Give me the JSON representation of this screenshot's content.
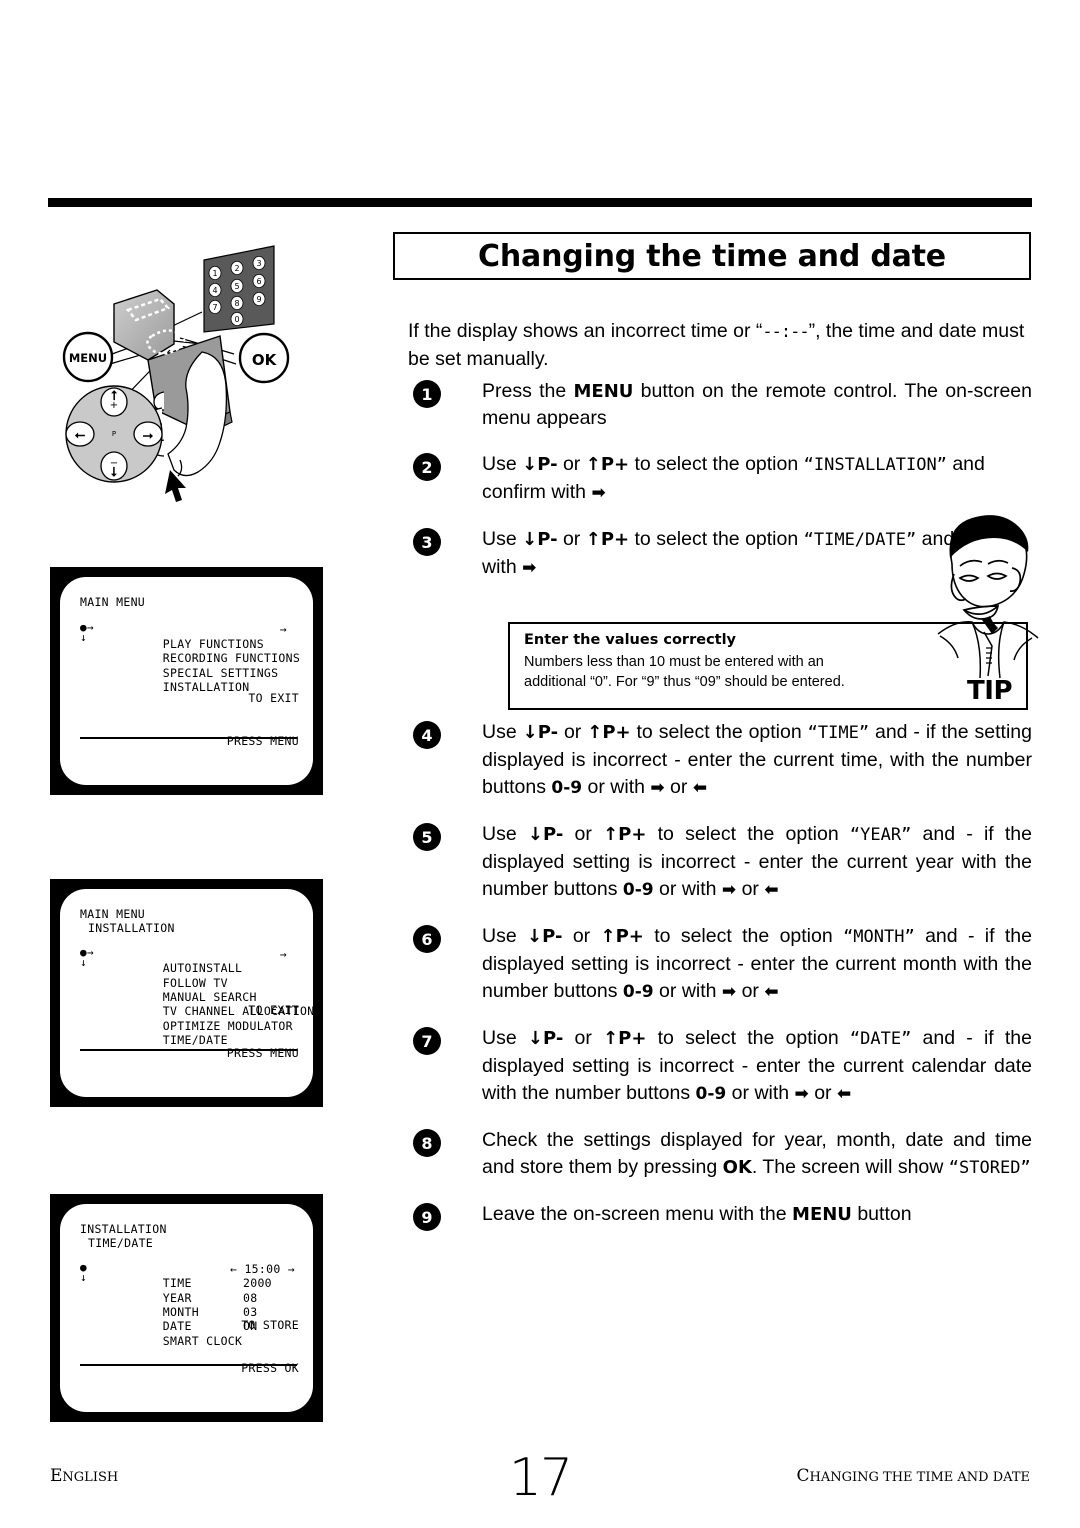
{
  "page": {
    "title": "Changing the time and date",
    "intro_before": "If the display shows an incorrect time or “",
    "intro_placeholder": "--:--",
    "intro_after": "”, the time and date must be set manually."
  },
  "steps": [
    {
      "num": "1",
      "parts": [
        {
          "t": "Press  the  ",
          "s": "n"
        },
        {
          "t": "MENU",
          "s": "b"
        },
        {
          "t": "  button  on  the  remote control. The on-screen menu appears",
          "s": "n"
        }
      ]
    },
    {
      "num": "2",
      "parts": [
        {
          "t": "Use  ",
          "s": "n"
        },
        {
          "t": "↓P-",
          "s": "b"
        },
        {
          "t": "  or  ",
          "s": "n"
        },
        {
          "t": "↑P+",
          "s": "b"
        },
        {
          "t": "  to  select  the  option ",
          "s": "n"
        },
        {
          "t": "“INSTALLATION”",
          "s": "m"
        },
        {
          "t": " and confirm with ",
          "s": "n"
        },
        {
          "t": "➡",
          "s": "a"
        }
      ]
    },
    {
      "num": "3",
      "parts": [
        {
          "t": "Use  ",
          "s": "n"
        },
        {
          "t": "↓P-",
          "s": "b"
        },
        {
          "t": "  or  ",
          "s": "n"
        },
        {
          "t": "↑P+",
          "s": "b"
        },
        {
          "t": "  to  select  the  option ",
          "s": "n"
        },
        {
          "t": "“TIME∕DATE”",
          "s": "m"
        },
        {
          "t": " and confirm with ",
          "s": "n"
        },
        {
          "t": "➡",
          "s": "a"
        }
      ]
    },
    {
      "num": "4",
      "parts": [
        {
          "t": "Use ",
          "s": "n"
        },
        {
          "t": "↓P-",
          "s": "b"
        },
        {
          "t": " or ",
          "s": "n"
        },
        {
          "t": "↑P+",
          "s": "b"
        },
        {
          "t": " to select the option ",
          "s": "n"
        },
        {
          "t": "“TIME”",
          "s": "m"
        },
        {
          "t": " and    - if    the    setting    displayed    is incorrect -  enter the current time, with the number buttons ",
          "s": "n"
        },
        {
          "t": "0-9",
          "s": "p"
        },
        {
          "t": " or with ",
          "s": "n"
        },
        {
          "t": "➡",
          "s": "a"
        },
        {
          "t": "  or ",
          "s": "n"
        },
        {
          "t": "⬅",
          "s": "a"
        }
      ]
    },
    {
      "num": "5",
      "parts": [
        {
          "t": "Use ",
          "s": "n"
        },
        {
          "t": "↓P-",
          "s": "b"
        },
        {
          "t": " or ",
          "s": "n"
        },
        {
          "t": "↑P+",
          "s": "b"
        },
        {
          "t": " to select the option ",
          "s": "n"
        },
        {
          "t": "“YEAR”",
          "s": "m"
        },
        {
          "t": " and    - if    the    displayed    setting    is incorrect - enter the current year with the number buttons ",
          "s": "n"
        },
        {
          "t": "0-9",
          "s": "p"
        },
        {
          "t": " or with ",
          "s": "n"
        },
        {
          "t": "➡",
          "s": "a"
        },
        {
          "t": "  or ",
          "s": "n"
        },
        {
          "t": "⬅",
          "s": "a"
        }
      ]
    },
    {
      "num": "6",
      "parts": [
        {
          "t": "Use ",
          "s": "n"
        },
        {
          "t": "↓P-",
          "s": "b"
        },
        {
          "t": " or ",
          "s": "n"
        },
        {
          "t": "↑P+",
          "s": "b"
        },
        {
          "t": " to select the option ",
          "s": "n"
        },
        {
          "t": "“MONTH”",
          "s": "m"
        },
        {
          "t": " and - if the displayed setting is incorrect - enter the current month with the number buttons ",
          "s": "n"
        },
        {
          "t": "0-9",
          "s": "p"
        },
        {
          "t": " or with ",
          "s": "n"
        },
        {
          "t": "➡",
          "s": "a"
        },
        {
          "t": "  or ",
          "s": "n"
        },
        {
          "t": "⬅",
          "s": "a"
        }
      ]
    },
    {
      "num": "7",
      "parts": [
        {
          "t": "Use ",
          "s": "n"
        },
        {
          "t": "↓P-",
          "s": "b"
        },
        {
          "t": " or ",
          "s": "n"
        },
        {
          "t": "↑P+",
          "s": "b"
        },
        {
          "t": " to select the option ",
          "s": "n"
        },
        {
          "t": "“DATE”",
          "s": "m"
        },
        {
          "t": " and - if the displayed setting is incorrect -  enter the current calendar date with the number buttons ",
          "s": "n"
        },
        {
          "t": "0-9",
          "s": "p"
        },
        {
          "t": " or with ",
          "s": "n"
        },
        {
          "t": "➡",
          "s": "a"
        },
        {
          "t": "  or ",
          "s": "n"
        },
        {
          "t": "⬅",
          "s": "a"
        }
      ]
    },
    {
      "num": "8",
      "parts": [
        {
          "t": "Check the settings displayed for year, month, date  and  time  and  store  them  by  pressing ",
          "s": "n"
        },
        {
          "t": "OK",
          "s": "b"
        },
        {
          "t": ". The screen will show ",
          "s": "n"
        },
        {
          "t": "“STORED”",
          "s": "m"
        }
      ]
    },
    {
      "num": "9",
      "parts": [
        {
          "t": "Leave the on-screen menu with the ",
          "s": "n"
        },
        {
          "t": "MENU",
          "s": "b"
        },
        {
          "t": " button",
          "s": "n"
        }
      ]
    }
  ],
  "tip": {
    "heading": "Enter the values correctly",
    "line1": "Numbers  less  than  10  must  be  entered  with  an",
    "line2": "additional “0”. For “9” thus “09” should be entered.",
    "badge": "TIP"
  },
  "screens": [
    {
      "id": "main-menu",
      "title": "MAIN MENU",
      "subtitle": "",
      "items": [
        {
          "label": "PLAY FUNCTIONS",
          "value": "",
          "cursor": true,
          "rowarrow": "→"
        },
        {
          "label": "RECORDING FUNCTIONS",
          "value": "",
          "cursor": false,
          "rowarrow": ""
        },
        {
          "label": "SPECIAL SETTINGS",
          "value": "",
          "cursor": false,
          "rowarrow": ""
        },
        {
          "label": "INSTALLATION",
          "value": "",
          "cursor": false,
          "rowarrow": ""
        }
      ],
      "footer1": "TO EXIT",
      "footer2": "PRESS MENU"
    },
    {
      "id": "installation-menu",
      "title": "MAIN MENU",
      "subtitle": "INSTALLATION",
      "items": [
        {
          "label": "AUTOINSTALL",
          "value": "",
          "cursor": true,
          "rowarrow": "→"
        },
        {
          "label": "FOLLOW TV",
          "value": "",
          "cursor": false,
          "rowarrow": ""
        },
        {
          "label": "MANUAL SEARCH",
          "value": "",
          "cursor": false,
          "rowarrow": ""
        },
        {
          "label": "TV CHANNEL ALLOCATION",
          "value": "",
          "cursor": false,
          "rowarrow": ""
        },
        {
          "label": "OPTIMIZE MODULATOR",
          "value": "",
          "cursor": false,
          "rowarrow": ""
        },
        {
          "label": "TIME/DATE",
          "value": "",
          "cursor": false,
          "rowarrow": ""
        }
      ],
      "footer1": "TO EXIT",
      "footer2": "PRESS MENU"
    },
    {
      "id": "time-date-menu",
      "title": "INSTALLATION",
      "subtitle": "TIME/DATE",
      "items": [
        {
          "label": "TIME",
          "value": "← 15:00 →",
          "cursor": true,
          "rowarrow": "",
          "arrows": true
        },
        {
          "label": "YEAR",
          "value": "2000",
          "cursor": false,
          "rowarrow": ""
        },
        {
          "label": "MONTH",
          "value": "08",
          "cursor": false,
          "rowarrow": ""
        },
        {
          "label": "DATE",
          "value": "03",
          "cursor": false,
          "rowarrow": ""
        },
        {
          "label": "SMART CLOCK",
          "value": "ON",
          "cursor": false,
          "rowarrow": ""
        }
      ],
      "footer1": "TO STORE",
      "footer2": "PRESS OK"
    }
  ],
  "remote": {
    "menu_label": "MENU",
    "ok_label": "OK",
    "keypad": [
      "1",
      "2",
      "3",
      "4",
      "5",
      "6",
      "7",
      "8",
      "9",
      "0"
    ],
    "pad_plus": "+",
    "pad_minus": "-",
    "pad_p": "P"
  },
  "footer": {
    "language_first": "E",
    "language_rest": "NGLISH",
    "page_number": "17",
    "chapter_first": "C",
    "chapter_rest": "HANGING THE TIME AND  DATE"
  }
}
